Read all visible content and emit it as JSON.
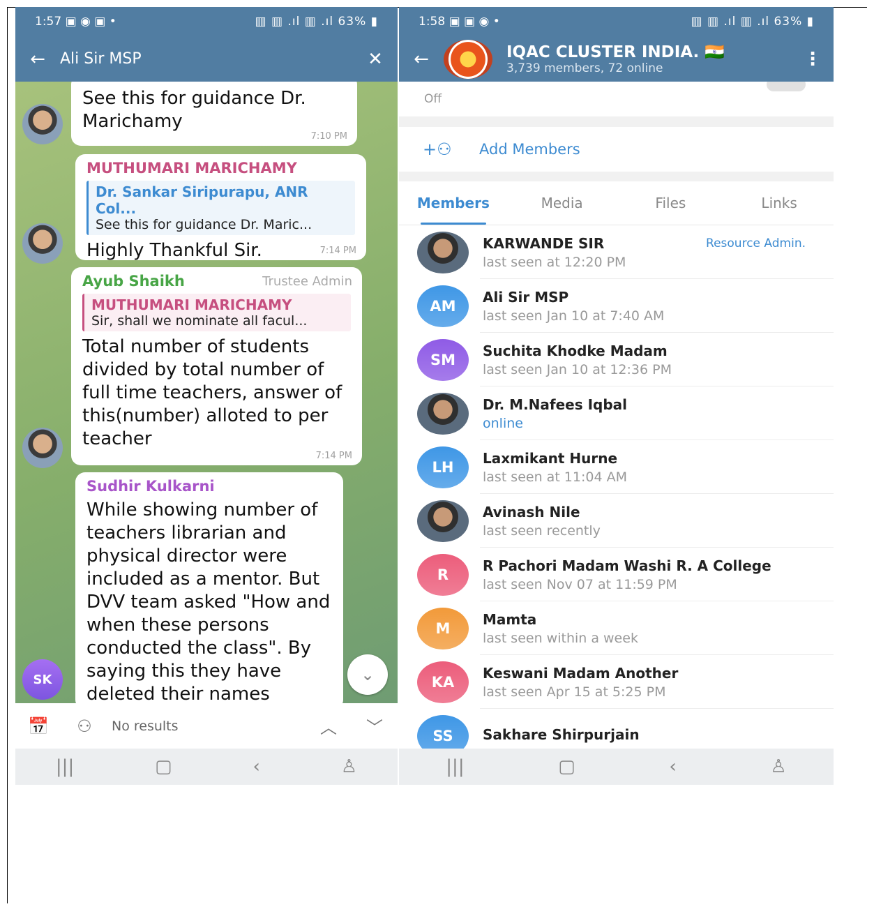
{
  "left": {
    "status": {
      "time": "1:57 ▣ ◉ ▣ •",
      "icons": "▥ ▥ .ıl ▥ .ıl 63% ▮"
    },
    "header": {
      "title": "Ali Sir MSP"
    },
    "messages": [
      {
        "sender": "",
        "body": "See this for guidance Dr. Marichamy",
        "time": "7:10 PM"
      },
      {
        "sender": "MUTHUMARI MARICHAMY",
        "reply_name": "Dr. Sankar Siripurapu, ANR Col...",
        "reply_text": "See this for guidance Dr. Maric...",
        "body": "Highly Thankful Sir.",
        "time": "7:14 PM"
      },
      {
        "sender": "Ayub Shaikh",
        "role": "Trustee Admin",
        "reply_name": "MUTHUMARI MARICHAMY",
        "reply_text": "Sir, shall we nominate all facul...",
        "body": "Total number of students divided by total number of full time teachers, answer of this(number) alloted to per teacher",
        "time": "7:14 PM"
      },
      {
        "sender": "Sudhir Kulkarni",
        "body": "While showing number of teachers librarian and physical director were included as a mentor. But DVV team asked \"How and when these persons conducted the class\". By saying this they have deleted their names"
      }
    ],
    "sk_initials": "SK",
    "search": {
      "no_results": "No results"
    }
  },
  "right": {
    "status": {
      "time": "1:58 ▣ ▣ ◉ •",
      "icons": "▥ ▥ .ıl ▥ .ıl 63% ▮"
    },
    "header": {
      "title": "IQAC CLUSTER INDIA. 🇮🇳",
      "subtitle": "3,739 members, 72 online"
    },
    "off_label": "Off",
    "add_members": "Add Members",
    "tabs": [
      "Members",
      "Media",
      "Files",
      "Links"
    ],
    "members": [
      {
        "name": "KARWANDE SIR",
        "status": "last seen at 12:20 PM",
        "role": "Resource Admin.",
        "initials": "",
        "color": ""
      },
      {
        "name": "Ali Sir MSP",
        "status": "last seen Jan 10 at 7:40 AM",
        "initials": "AM",
        "color": "#3f97e6"
      },
      {
        "name": "Suchita Khodke Madam",
        "status": "last seen Jan 10 at 12:36 PM",
        "initials": "SM",
        "color": "#8f5be6"
      },
      {
        "name": "Dr. M.Nafees Iqbal",
        "status": "online",
        "initials": "",
        "color": ""
      },
      {
        "name": "Laxmikant Hurne",
        "status": "last seen at 11:04 AM",
        "initials": "LH",
        "color": "#3f97e6"
      },
      {
        "name": "Avinash Nile",
        "status": "last seen recently",
        "initials": "",
        "color": ""
      },
      {
        "name": "R Pachori Madam Washi R. A College",
        "status": "last seen Nov 07 at 11:59 PM",
        "initials": "R",
        "color": "#ec5d7b"
      },
      {
        "name": "Mamta",
        "status": "last seen within a week",
        "initials": "M",
        "color": "#f29a3a"
      },
      {
        "name": "Keswani Madam Another",
        "status": "last seen Apr 15 at 5:25 PM",
        "initials": "KA",
        "color": "#ec5d7b"
      },
      {
        "name": "Sakhare Shirpurjain",
        "status": "",
        "initials": "SS",
        "color": "#3f97e6"
      }
    ]
  },
  "colors": {
    "header": "#517da2",
    "accent": "#3d8bd1"
  }
}
